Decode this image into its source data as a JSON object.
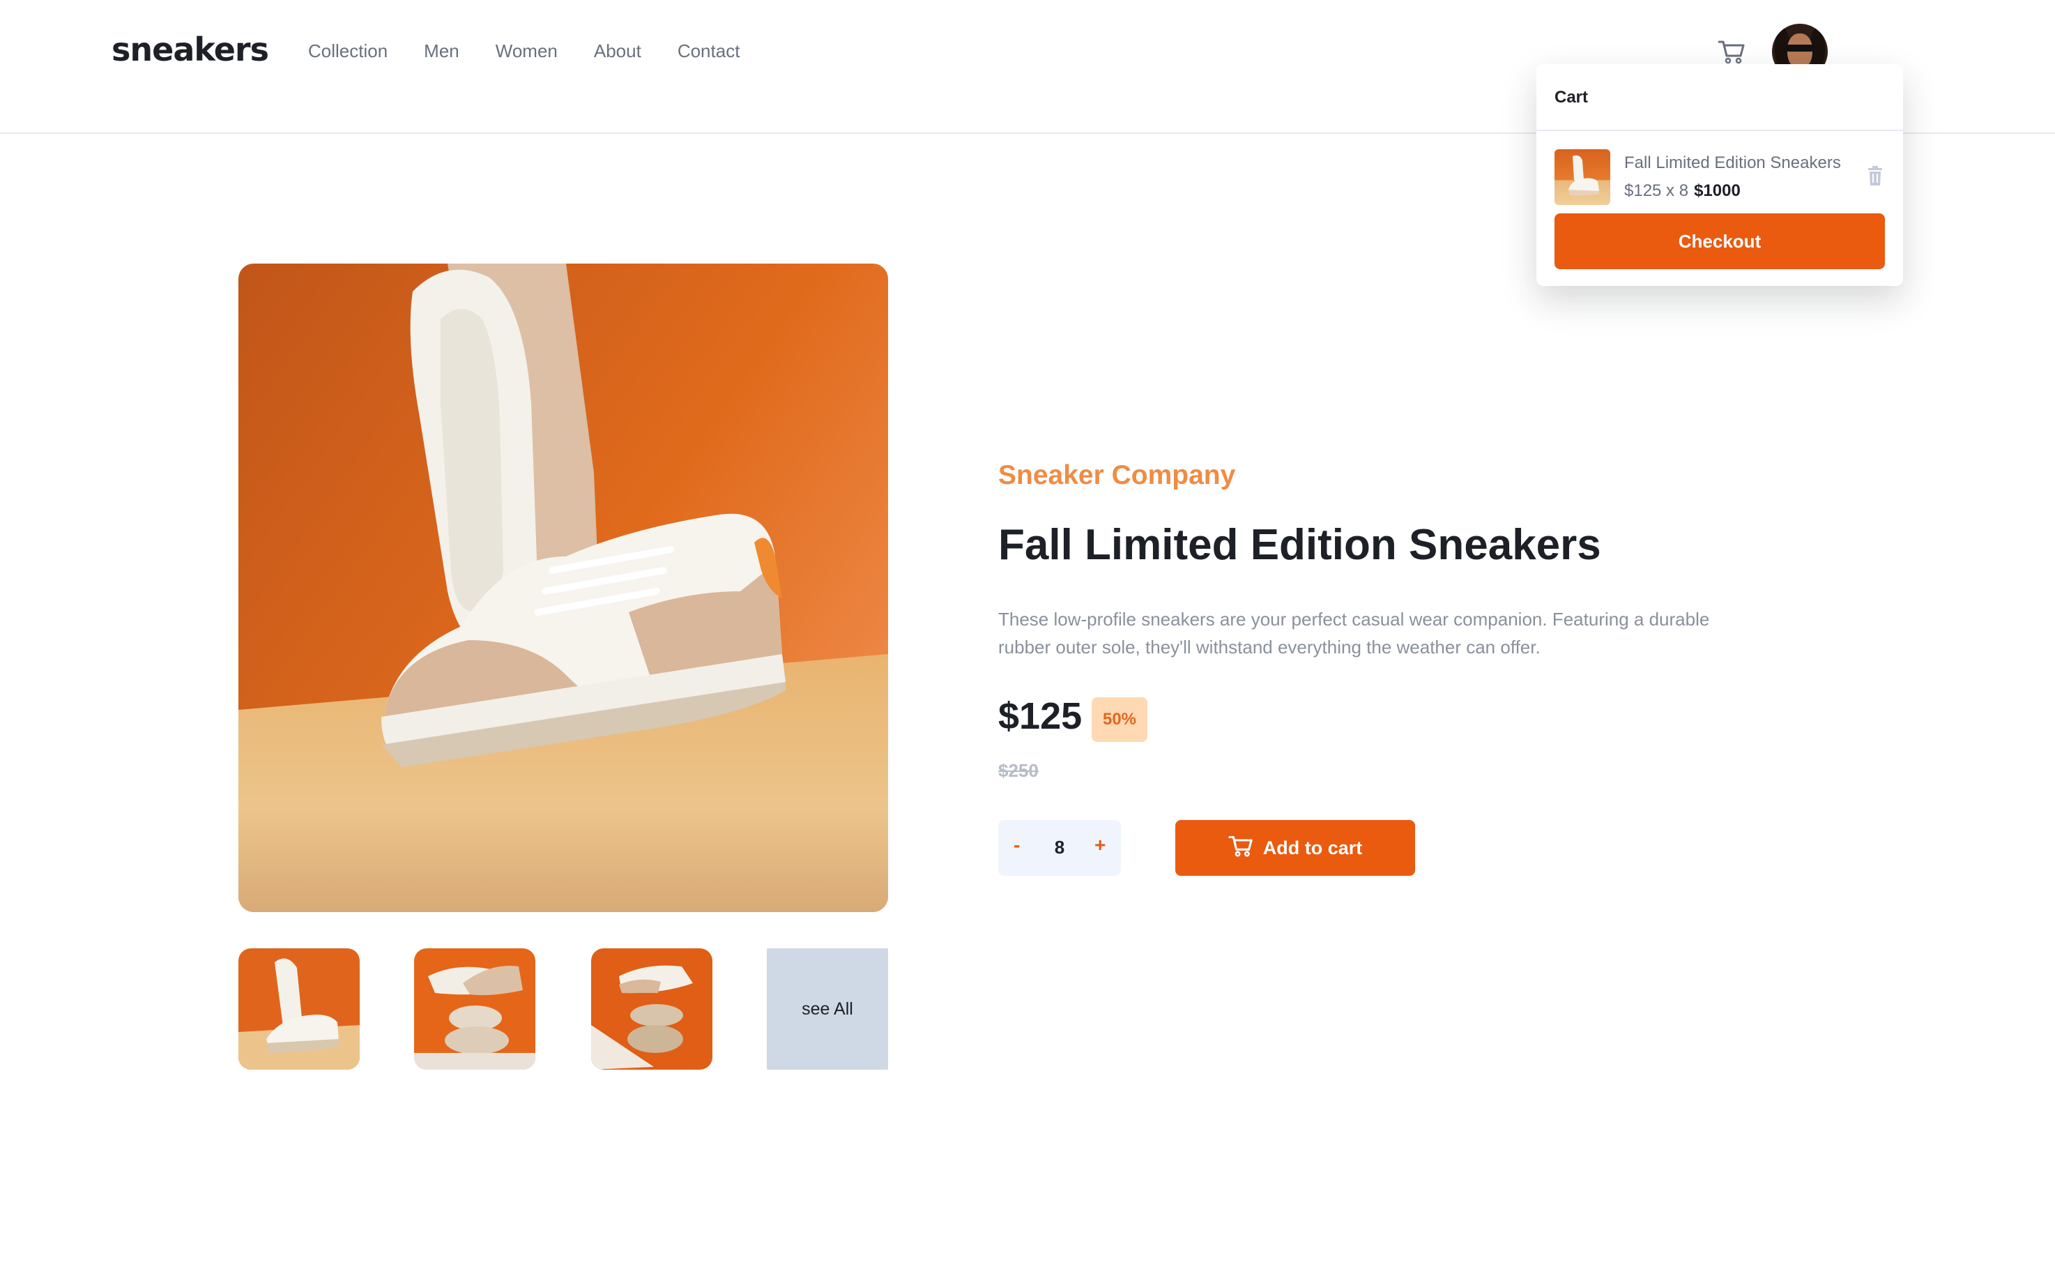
{
  "header": {
    "logo": "sneakers",
    "nav": [
      "Collection",
      "Men",
      "Women",
      "About",
      "Contact"
    ]
  },
  "cart": {
    "title": "Cart",
    "item_name": "Fall Limited Edition Sneakers",
    "item_calc": "$125 x 8",
    "item_total": "$1000",
    "checkout_label": "Checkout"
  },
  "product": {
    "company": "Sneaker Company",
    "title": "Fall Limited Edition Sneakers",
    "description": "These low-profile sneakers are your perfect casual wear companion. Featuring a durable rubber outer sole, they'll withstand everything the weather can offer.",
    "price": "$125",
    "discount": "50%",
    "old_price": "$250",
    "quantity": "8",
    "minus_label": "-",
    "plus_label": "+",
    "add_label": "Add to cart"
  },
  "gallery": {
    "see_all_label": "see All"
  },
  "colors": {
    "accent": "#ea5a0f",
    "company": "#ee8c45",
    "badge_bg": "#ffd9b3",
    "dark": "#1d2026"
  },
  "icons": {
    "cart": "cart-icon",
    "trash": "trash-icon"
  }
}
